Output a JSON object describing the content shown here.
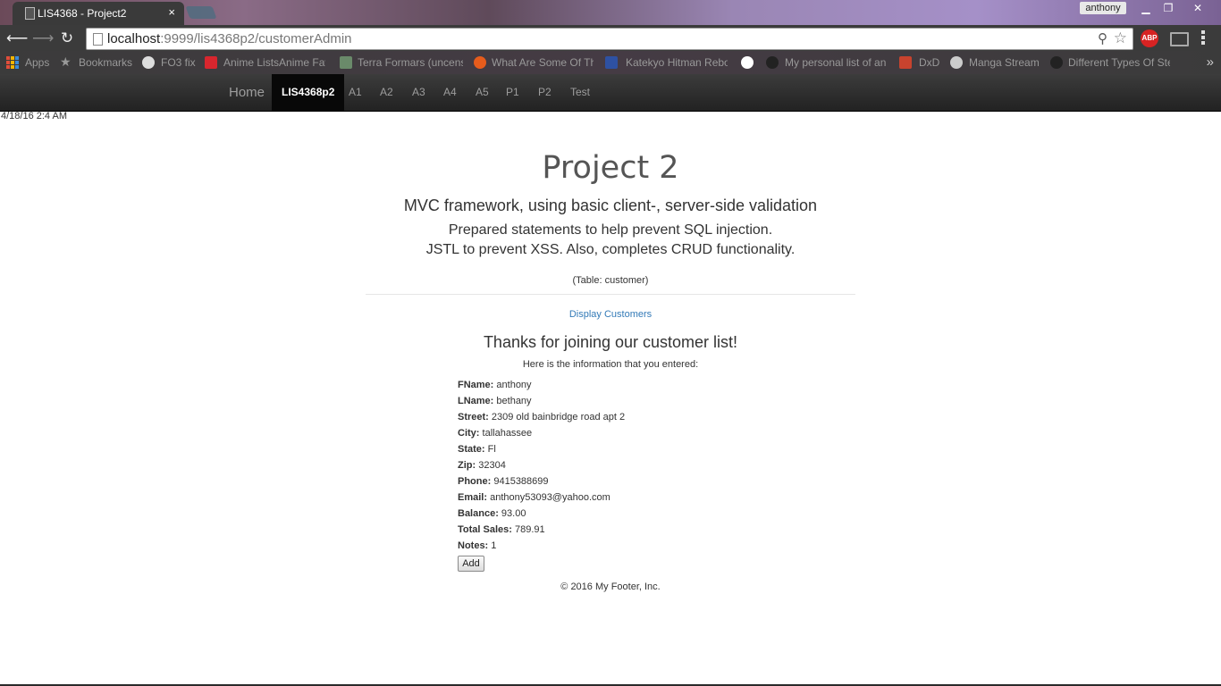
{
  "browser": {
    "tab_title": "LIS4368 - Project2",
    "tab_close": "×",
    "user": "anthony",
    "url_host": "localhost",
    "url_rest": ":9999/lis4368p2/customerAdmin",
    "bookmarks": [
      "Apps",
      "Bookmarks",
      "FO3 fix",
      "Anime ListsAnime Fav",
      "Terra Formars (uncens",
      "What Are Some Of Th",
      "Katekyo Hitman Rebo",
      "My personal list of an",
      "DxD",
      "Manga Stream",
      "Different Types Of Ste"
    ],
    "abp_label": "ABP",
    "window_buttons": [
      "▁",
      "❐",
      "✕"
    ],
    "nav_glyphs": {
      "back": "⟵",
      "forward": "⟶",
      "reload": "↻",
      "zoom": "⚲",
      "star": "☆",
      "more": "»"
    }
  },
  "navbar": {
    "brand": "Home",
    "active": "LIS4368p2",
    "items": [
      "A1",
      "A2",
      "A3",
      "A4",
      "A5",
      "P1",
      "P2",
      "Test"
    ]
  },
  "page": {
    "timestamp": "4/18/16 2:4 AM",
    "title": "Project 2",
    "subtitle": "MVC framework, using basic client-, server-side validation",
    "line1": "Prepared statements to help prevent SQL injection.",
    "line2": "JSTL to prevent XSS. Also, completes CRUD functionality.",
    "table_note": "(Table: customer)",
    "display_link": "Display Customers",
    "thanks": "Thanks for joining our customer list!",
    "intro": "Here is the information that you entered:",
    "fields": [
      {
        "label": "FName:",
        "value": "anthony"
      },
      {
        "label": "LName:",
        "value": "bethany"
      },
      {
        "label": "Street:",
        "value": "2309 old bainbridge road apt 2"
      },
      {
        "label": "City:",
        "value": "tallahassee"
      },
      {
        "label": "State:",
        "value": "Fl"
      },
      {
        "label": "Zip:",
        "value": "32304"
      },
      {
        "label": "Phone:",
        "value": "9415388699"
      },
      {
        "label": "Email:",
        "value": "anthony53093@yahoo.com"
      },
      {
        "label": "Balance:",
        "value": "93.00"
      },
      {
        "label": "Total Sales:",
        "value": "789.91"
      },
      {
        "label": "Notes:",
        "value": "1"
      }
    ],
    "add_button": "Add",
    "footer": "© 2016 My Footer, Inc."
  }
}
